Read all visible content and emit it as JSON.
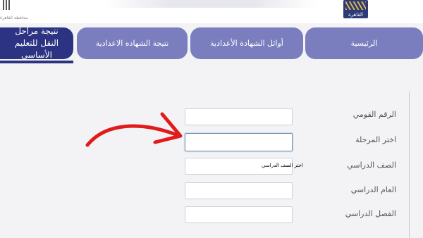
{
  "header": {
    "logo_right_text": "القاهرة",
    "logo_left_text": "محافظة القاهرة"
  },
  "nav": {
    "tabs": [
      {
        "label": "الرئيسية"
      },
      {
        "label": "أوائل الشهادة الأعدادية"
      },
      {
        "label": "نتيجة الشهاده الاعدادية"
      },
      {
        "label": "نتيجة مراحل النقل للتعليم الأساسي"
      }
    ]
  },
  "form": {
    "fields": [
      {
        "label": "الرقم القومي",
        "value": ""
      },
      {
        "label": "اختر المرحلة",
        "value": ""
      },
      {
        "label": "الصف الدراسي",
        "value": "اختر الصف الدراسي"
      },
      {
        "label": "العام الدراسي",
        "value": ""
      },
      {
        "label": "الفصل الدراسي",
        "value": ""
      }
    ]
  },
  "annotation": {
    "arrow_color": "#e11b1b"
  }
}
